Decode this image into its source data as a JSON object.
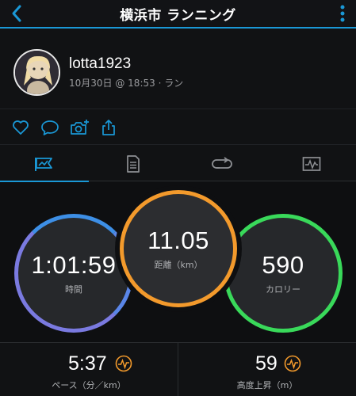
{
  "header": {
    "title": "横浜市 ランニング",
    "back_icon": "chevron-left-icon",
    "menu_icon": "kebab-menu-icon"
  },
  "profile": {
    "username": "lotta1923",
    "meta": "10月30日 @ 18:53 · ラン"
  },
  "actions": [
    "like-icon",
    "comment-icon",
    "add-photo-icon",
    "share-icon"
  ],
  "tabs": [
    "summary-tab",
    "details-tab",
    "laps-tab",
    "charts-tab"
  ],
  "metrics": {
    "time": {
      "value": "1:01:59",
      "label": "時間"
    },
    "distance": {
      "value": "11.05",
      "label": "距離（km）"
    },
    "calories": {
      "value": "590",
      "label": "カロリー"
    }
  },
  "stats": {
    "pace": {
      "value": "5:37",
      "label": "ペース（分／km）"
    },
    "elevation": {
      "value": "59",
      "label": "高度上昇（m）"
    }
  },
  "colors": {
    "accent": "#1a98d6",
    "distance_ring": "#f39a2c",
    "calorie_ring": "#39d95a",
    "time_ring": "#7a7ae0"
  }
}
